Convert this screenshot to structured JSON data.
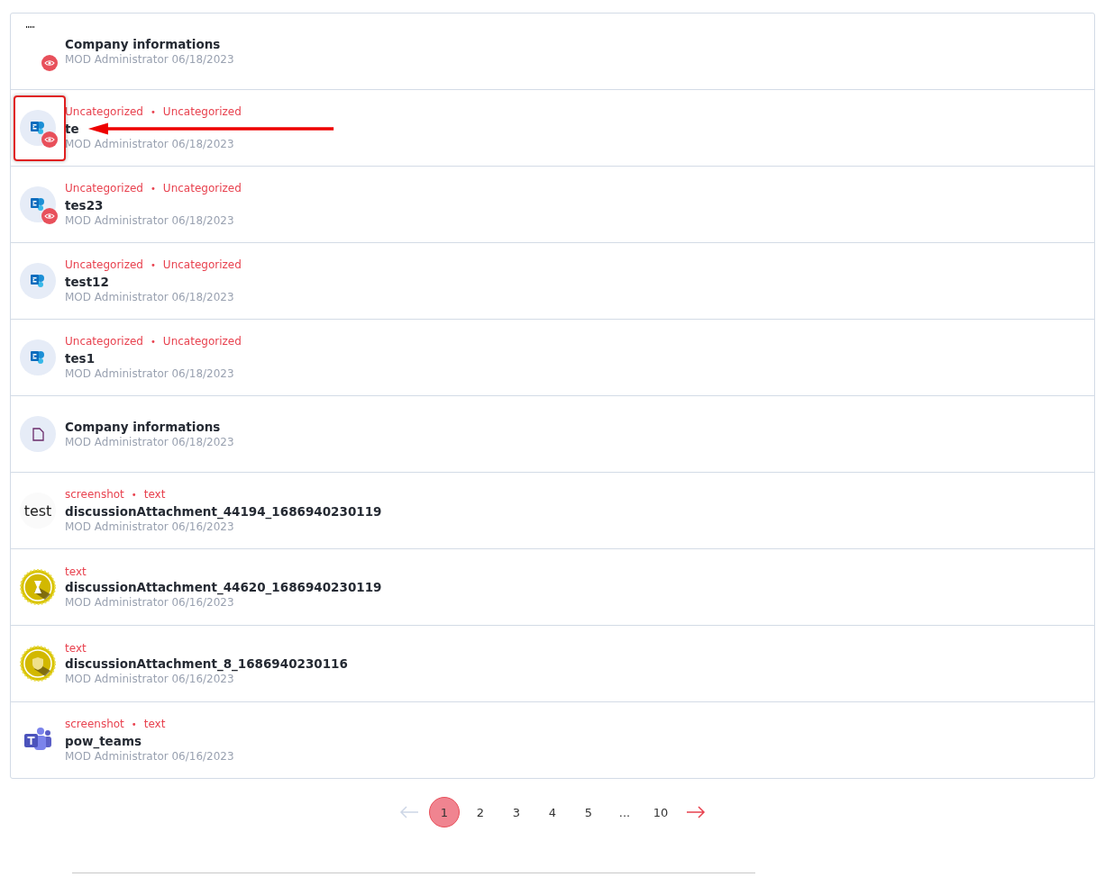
{
  "items": [
    {
      "kind": "blank",
      "viewed": true,
      "title": "Company informations",
      "meta": "MOD Administrator 06/18/2023",
      "annotated": false
    },
    {
      "kind": "sharepoint",
      "viewed": true,
      "categories": [
        "Uncategorized",
        "Uncategorized"
      ],
      "separator": "•",
      "title": "te",
      "meta": "MOD Administrator 06/18/2023",
      "annotated": true
    },
    {
      "kind": "sharepoint",
      "viewed": true,
      "categories": [
        "Uncategorized",
        "Uncategorized"
      ],
      "separator": "•",
      "title": "tes23",
      "meta": "MOD Administrator 06/18/2023",
      "annotated": false
    },
    {
      "kind": "sharepoint",
      "viewed": false,
      "categories": [
        "Uncategorized",
        "Uncategorized"
      ],
      "separator": "•",
      "title": "test12",
      "meta": "MOD Administrator 06/18/2023",
      "annotated": false
    },
    {
      "kind": "sharepoint",
      "viewed": false,
      "categories": [
        "Uncategorized",
        "Uncategorized"
      ],
      "separator": "•",
      "title": "tes1",
      "meta": "MOD Administrator 06/18/2023",
      "annotated": false
    },
    {
      "kind": "file",
      "viewed": false,
      "title": "Company informations",
      "meta": "MOD Administrator 06/18/2023",
      "annotated": false
    },
    {
      "kind": "thumbnail",
      "thumb_text": "test",
      "viewed": false,
      "categories": [
        "screenshot",
        "text"
      ],
      "separator": "•",
      "title": "discussionAttachment_44194_1686940230119",
      "meta": "MOD Administrator 06/16/2023",
      "annotated": false
    },
    {
      "kind": "hourglass",
      "viewed": false,
      "categories": [
        "text"
      ],
      "title": "discussionAttachment_44620_1686940230119",
      "meta": "MOD Administrator 06/16/2023",
      "annotated": false
    },
    {
      "kind": "shield",
      "viewed": false,
      "categories": [
        "text"
      ],
      "title": "discussionAttachment_8_1686940230116",
      "meta": "MOD Administrator 06/16/2023",
      "annotated": false
    },
    {
      "kind": "teams",
      "viewed": false,
      "categories": [
        "screenshot",
        "text"
      ],
      "separator": "•",
      "title": "pow_teams",
      "meta": "MOD Administrator 06/16/2023",
      "annotated": false
    }
  ],
  "pagination": {
    "prev_disabled": true,
    "next_disabled": false,
    "pages": [
      {
        "label": "1",
        "selected": true
      },
      {
        "label": "2",
        "selected": false
      },
      {
        "label": "3",
        "selected": false
      },
      {
        "label": "4",
        "selected": false
      },
      {
        "label": "5",
        "selected": false
      },
      {
        "label": "...",
        "selected": false
      },
      {
        "label": "10",
        "selected": false
      }
    ]
  }
}
